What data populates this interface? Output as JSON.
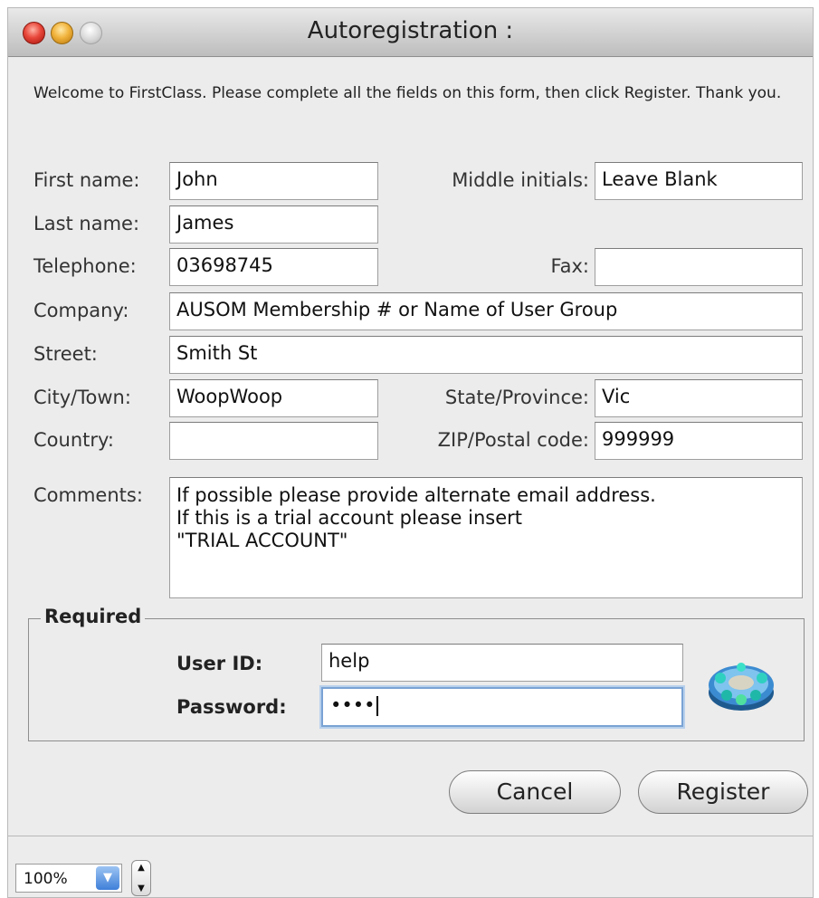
{
  "window": {
    "title": "Autoregistration :"
  },
  "intro": "Welcome to FirstClass.  Please complete all the fields on this form, then click Register.  Thank you.",
  "fields": {
    "first_name": {
      "label": "First name:",
      "value": "John"
    },
    "middle_initials": {
      "label": "Middle initials:",
      "value": "Leave Blank"
    },
    "last_name": {
      "label": "Last name:",
      "value": "James"
    },
    "telephone": {
      "label": "Telephone:",
      "value": "03698745"
    },
    "fax": {
      "label": "Fax:",
      "value": ""
    },
    "company": {
      "label": "Company:",
      "value": "AUSOM Membership # or Name of User Group"
    },
    "street": {
      "label": "Street:",
      "value": "Smith St"
    },
    "city": {
      "label": "City/Town:",
      "value": "WoopWoop"
    },
    "state": {
      "label": "State/Province:",
      "value": "Vic"
    },
    "country": {
      "label": "Country:",
      "value": ""
    },
    "zip": {
      "label": "ZIP/Postal code:",
      "value": "999999"
    },
    "comments": {
      "label": "Comments:",
      "value": "If possible please provide alternate email address.\nIf this is a trial account please insert\n\"TRIAL ACCOUNT\""
    }
  },
  "required": {
    "title": "Required",
    "user_id": {
      "label": "User ID:",
      "value": "help"
    },
    "password": {
      "label": "Password:",
      "value": "••••"
    }
  },
  "buttons": {
    "cancel": "Cancel",
    "register": "Register"
  },
  "statusbar": {
    "zoom": "100%"
  },
  "colors": {
    "focus_ring": "#7aa3d4",
    "close": "#e8473a",
    "minimize": "#f1b33c"
  },
  "icons": {
    "app": "firstclass-app-icon"
  }
}
